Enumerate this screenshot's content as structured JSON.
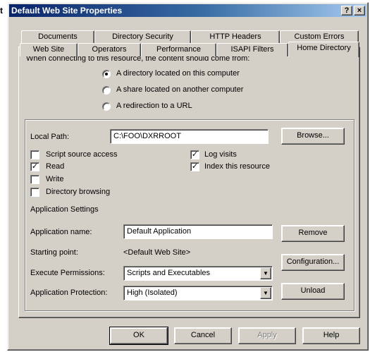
{
  "stray_char": "t",
  "window": {
    "title": "Default Web Site Properties",
    "help_button": "?",
    "close_button": "×"
  },
  "tabs_back": [
    "Documents",
    "Directory Security",
    "HTTP Headers",
    "Custom Errors"
  ],
  "tabs_front": [
    "Web Site",
    "Operators",
    "Performance",
    "ISAPI Filters",
    "Home Directory"
  ],
  "home": {
    "source_prompt": "When connecting to this resource, the content should come from:",
    "source_options": [
      {
        "label": "A directory located on this computer",
        "selected": true
      },
      {
        "label": "A share located on another computer",
        "selected": false
      },
      {
        "label": "A redirection to a URL",
        "selected": false
      }
    ],
    "local_path_label": "Local Path:",
    "local_path_value": "C:\\FOO\\DXRROOT",
    "browse_label": "Browse...",
    "checks_left": [
      {
        "label": "Script source access",
        "checked": false
      },
      {
        "label": "Read",
        "checked": true
      },
      {
        "label": "Write",
        "checked": false
      },
      {
        "label": "Directory browsing",
        "checked": false
      }
    ],
    "checks_right": [
      {
        "label": "Log visits",
        "checked": true
      },
      {
        "label": "Index this resource",
        "checked": true
      }
    ],
    "check_mark": "✓",
    "app_settings_heading": "Application Settings",
    "app_name_label": "Application name:",
    "app_name_value": "Default Application",
    "remove_label": "Remove",
    "starting_point_label": "Starting point:",
    "starting_point_value": "<Default Web Site>",
    "configuration_label": "Configuration...",
    "exec_perm_label": "Execute Permissions:",
    "exec_perm_value": "Scripts and Executables",
    "app_protection_label": "Application Protection:",
    "app_protection_value": "High (Isolated)",
    "unload_label": "Unload",
    "dropdown_glyph": "▼"
  },
  "footer": {
    "ok": "OK",
    "cancel": "Cancel",
    "apply": "Apply",
    "help": "Help"
  }
}
